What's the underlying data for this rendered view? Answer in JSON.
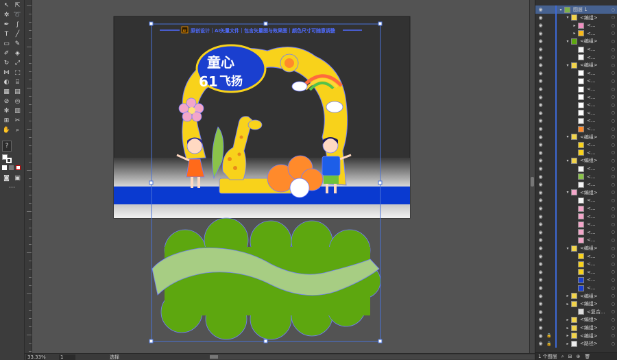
{
  "window": {
    "zoom_value": "33.33%",
    "page_value": "1",
    "mode_label": "选择"
  },
  "artwork": {
    "banner_text": "原创设计｜AI矢量文件｜包含矢量图与效果图｜颜色尺寸可随意调整",
    "ai_badge": "Ai",
    "title_line1": "童心",
    "title_number": "61",
    "title_line2": "飞扬"
  },
  "colors": {
    "selection": "#4a73d9",
    "banner_text": "#4f6bff",
    "yellow_frame": "#f8d21b",
    "blue_stage": "#0a3ad0",
    "grass_green": "#5da70f",
    "grass_path": "#a7cd83",
    "dark_board": "#323232"
  },
  "layers_panel": {
    "rows": [
      {
        "label": "图层 1",
        "thumb": "folder-thumb-icon"
      },
      {
        "label": "<编组>",
        "thumb": "group-thumb-icon"
      },
      {
        "label": "<...",
        "thumb": "flower-thumb-icon"
      },
      {
        "label": "<...",
        "thumb": "sun-thumb-icon"
      },
      {
        "label": "<编组>",
        "thumb": "grass-thumb-icon"
      },
      {
        "label": "<...",
        "thumb": "shape-thumb-icon"
      },
      {
        "label": "<...",
        "thumb": "shape-thumb-icon"
      },
      {
        "label": "<编组>",
        "thumb": "group-thumb-icon"
      },
      {
        "label": "<...",
        "thumb": "stroke-thumb-icon"
      },
      {
        "label": "<...",
        "thumb": "stroke-thumb-icon"
      },
      {
        "label": "<...",
        "thumb": "stroke-thumb-icon"
      },
      {
        "label": "<...",
        "thumb": "stroke-thumb-icon"
      },
      {
        "label": "<...",
        "thumb": "stroke-thumb-icon"
      },
      {
        "label": "<...",
        "thumb": "stroke-thumb-icon"
      },
      {
        "label": "<...",
        "thumb": "shape-thumb-icon"
      },
      {
        "label": "<...",
        "thumb": "orange-thumb-icon"
      },
      {
        "label": "<编组>",
        "thumb": "group-thumb-icon"
      },
      {
        "label": "<...",
        "thumb": "yellow-thumb-icon"
      },
      {
        "label": "<...",
        "thumb": "yellow-thumb-icon"
      },
      {
        "label": "<编组>",
        "thumb": "group-thumb-icon"
      },
      {
        "label": "<...",
        "thumb": "shape-thumb-icon"
      },
      {
        "label": "<...",
        "thumb": "green-thumb-icon"
      },
      {
        "label": "<...",
        "thumb": "shape-thumb-icon"
      },
      {
        "label": "<编组>",
        "thumb": "pink-thumb-icon"
      },
      {
        "label": "<...",
        "thumb": "shape-thumb-icon"
      },
      {
        "label": "<...",
        "thumb": "pink-thumb-icon"
      },
      {
        "label": "<...",
        "thumb": "pink-thumb-icon"
      },
      {
        "label": "<...",
        "thumb": "pink-thumb-icon"
      },
      {
        "label": "<...",
        "thumb": "pink-thumb-icon"
      },
      {
        "label": "<...",
        "thumb": "pink-thumb-icon"
      },
      {
        "label": "<编组>",
        "thumb": "group-thumb-icon"
      },
      {
        "label": "<...",
        "thumb": "yellow-thumb-icon"
      },
      {
        "label": "<...",
        "thumb": "yellow-thumb-icon"
      },
      {
        "label": "<...",
        "thumb": "yellow-thumb-icon"
      },
      {
        "label": "<...",
        "thumb": "blue-thumb-icon"
      },
      {
        "label": "<...",
        "thumb": "blue-thumb-icon"
      },
      {
        "label": "<编组>",
        "thumb": "group-thumb-icon"
      },
      {
        "label": "<编组>",
        "thumb": "group-thumb-icon"
      },
      {
        "label": "<复合...",
        "thumb": "compound-thumb-icon"
      },
      {
        "label": "<编组>",
        "thumb": "group-thumb-icon"
      },
      {
        "label": "<编组>",
        "thumb": "group-thumb-icon"
      },
      {
        "label": "<编组>",
        "thumb": "group-thumb-icon"
      },
      {
        "label": "<路径>",
        "thumb": "path-thumb-icon"
      }
    ],
    "footer_count": "1 个图层"
  }
}
